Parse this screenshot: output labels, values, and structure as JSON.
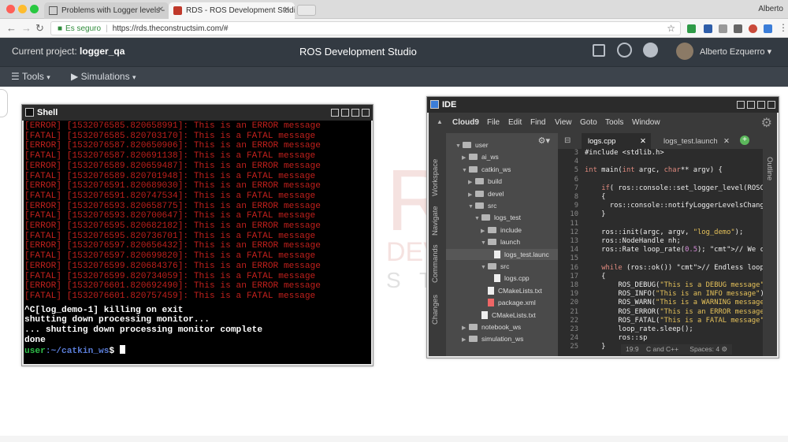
{
  "browser": {
    "tabs": [
      {
        "label": "Problems with Logger levels -",
        "active": false
      },
      {
        "label": "RDS - ROS Development Studi",
        "active": true
      }
    ],
    "user": "Alberto",
    "security_label": "Es seguro",
    "url": "https://rds.theconstructsim.com/#"
  },
  "header": {
    "project_label": "Current project:",
    "project_name": "logger_qa",
    "title": "ROS Development Studio",
    "user_name": "Alberto Ezquerro"
  },
  "toolbar": {
    "tools_label": "Tools",
    "simulations_label": "Simulations"
  },
  "shell": {
    "title": "Shell",
    "log_lines": [
      "[ERROR] [1532076585.820658991]: This is an ERROR message",
      "[FATAL] [1532076585.820703170]: This is a FATAL message",
      "[ERROR] [1532076587.820650906]: This is an ERROR message",
      "[FATAL] [1532076587.820691138]: This is a FATAL message",
      "[ERROR] [1532076589.820659487]: This is an ERROR message",
      "[FATAL] [1532076589.820701948]: This is a FATAL message",
      "[ERROR] [1532076591.820689030]: This is an ERROR message",
      "[FATAL] [1532076591.820747534]: This is a FATAL message",
      "[ERROR] [1532076593.820658775]: This is an ERROR message",
      "[FATAL] [1532076593.820700647]: This is a FATAL message",
      "[ERROR] [1532076595.820682182]: This is an ERROR message",
      "[FATAL] [1532076595.820736701]: This is a FATAL message",
      "[ERROR] [1532076597.820656432]: This is an ERROR message",
      "[FATAL] [1532076597.820699820]: This is a FATAL message",
      "[ERROR] [1532076599.820684376]: This is an ERROR message",
      "[FATAL] [1532076599.820734059]: This is a FATAL message",
      "[ERROR] [1532076601.820692490]: This is an ERROR message",
      "[FATAL] [1532076601.820757459]: This is a FATAL message"
    ],
    "output_lines": [
      "^C[log_demo-1] killing on exit",
      "shutting down processing monitor...",
      "... shutting down processing monitor complete",
      "done"
    ],
    "prompt_user": "user",
    "prompt_path": ":~/catkin_ws",
    "prompt_symbol": "$ "
  },
  "ide": {
    "title": "IDE",
    "menu": [
      "Cloud9",
      "File",
      "Edit",
      "Find",
      "View",
      "Goto",
      "Tools",
      "Window"
    ],
    "side_tabs": [
      "Workspace",
      "Navigate",
      "Commands",
      "Changes"
    ],
    "right_tab": "Outline",
    "tree": [
      {
        "label": "user",
        "kind": "folder",
        "open": true
      },
      {
        "label": "ai_ws",
        "kind": "folder",
        "open": false
      },
      {
        "label": "catkin_ws",
        "kind": "folder",
        "open": true
      },
      {
        "label": "build",
        "kind": "folder",
        "open": false
      },
      {
        "label": "devel",
        "kind": "folder",
        "open": false
      },
      {
        "label": "src",
        "kind": "folder",
        "open": true
      },
      {
        "label": "logs_test",
        "kind": "folder",
        "open": true
      },
      {
        "label": "include",
        "kind": "folder",
        "open": false
      },
      {
        "label": "launch",
        "kind": "folder",
        "open": true
      },
      {
        "label": "logs_test.launc",
        "kind": "file",
        "open": false
      },
      {
        "label": "src",
        "kind": "folder",
        "open": true
      },
      {
        "label": "logs.cpp",
        "kind": "file",
        "open": false
      },
      {
        "label": "CMakeLists.txt",
        "kind": "file",
        "open": false
      },
      {
        "label": "package.xml",
        "kind": "xml",
        "open": false
      },
      {
        "label": "CMakeLists.txt",
        "kind": "file",
        "open": false
      },
      {
        "label": "notebook_ws",
        "kind": "folder",
        "open": false
      },
      {
        "label": "simulation_ws",
        "kind": "folder",
        "open": false
      }
    ],
    "editor_tabs": [
      {
        "label": "logs.cpp",
        "active": true
      },
      {
        "label": "logs_test.launch",
        "active": false
      }
    ],
    "line_numbers": [
      "3",
      "4",
      "5",
      "6",
      "7",
      "8",
      "9",
      "10",
      "11",
      "12",
      "13",
      "14",
      "15",
      "16",
      "17",
      "18",
      "19",
      "20",
      "21",
      "22",
      "23",
      "24",
      "25"
    ],
    "code_lines": [
      "#include <stdlib.h>",
      "",
      "int main(int argc, char** argv) {",
      "",
      "    if( ros::console::set_logger_level(ROSCO",
      "    {",
      "      ros::console::notifyLoggerLevelsChange",
      "    }",
      "",
      "    ros::init(argc, argv, \"log_demo\");",
      "    ros::NodeHandle nh;",
      "    ros::Rate loop_rate(0.5); // We create a",
      "",
      "    while (ros::ok()) // Endless loop until",
      "    {",
      "        ROS_DEBUG(\"This is a DEBUG message\")",
      "        ROS_INFO(\"This is an INFO message\")",
      "        ROS_WARN(\"This is a WARNING message",
      "        ROS_ERROR(\"This is an ERROR message",
      "        ROS_FATAL(\"This is a FATAL message\")",
      "        loop_rate.sleep();",
      "        ros::sp",
      "    }"
    ],
    "status_position": "19:9",
    "status_language": "C and C++",
    "status_spaces": "Spaces: 4"
  },
  "watermark": {
    "letters": [
      "R",
      "S"
    ],
    "words": [
      "DEV",
      "S T"
    ]
  }
}
